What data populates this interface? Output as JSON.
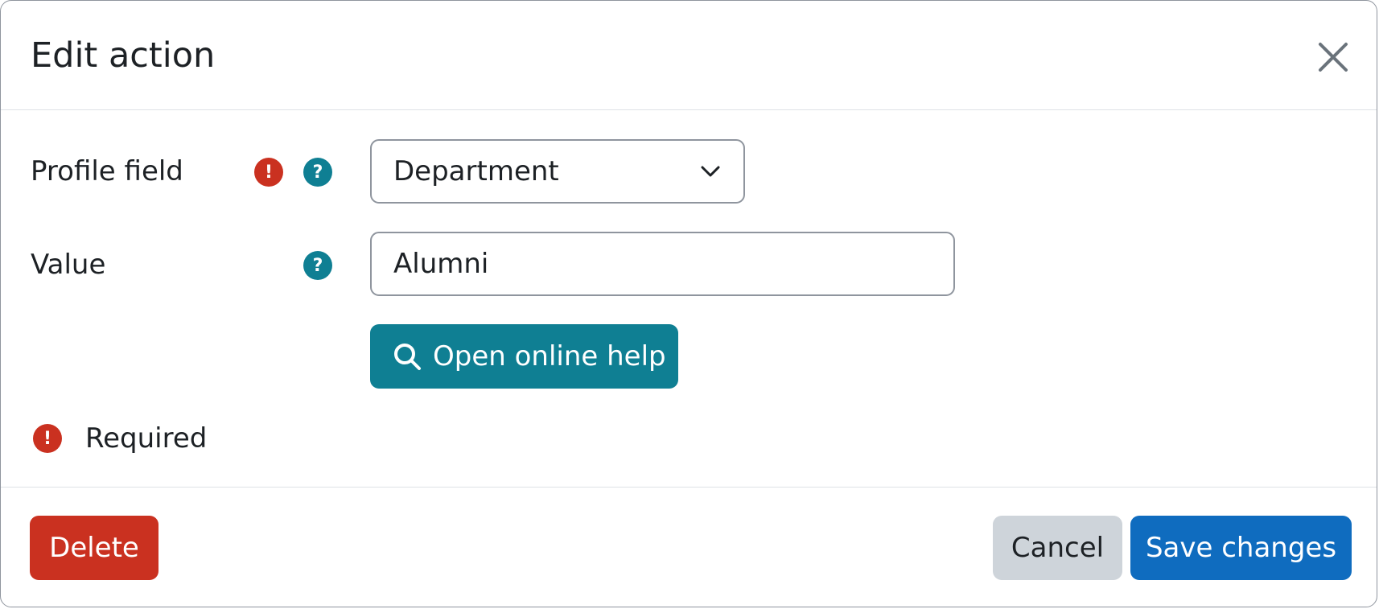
{
  "modal": {
    "title": "Edit action",
    "close_icon": "close-icon"
  },
  "form": {
    "profile_field": {
      "label": "Profile field",
      "required_icon": "exclamation-icon",
      "help_icon": "question-icon",
      "selected_value": "Department"
    },
    "value": {
      "label": "Value",
      "help_icon": "question-icon",
      "input_value": "Alumni"
    },
    "online_help_button": {
      "label": "Open online help",
      "icon": "search-icon"
    },
    "required_legend": {
      "icon": "exclamation-icon",
      "text": "Required"
    }
  },
  "footer": {
    "delete_label": "Delete",
    "cancel_label": "Cancel",
    "save_label": "Save changes"
  },
  "colors": {
    "required": "#ca3120",
    "help": "#0f7f93",
    "primary": "#0f6cbf",
    "secondary": "#ced4da",
    "danger": "#ca3120"
  }
}
